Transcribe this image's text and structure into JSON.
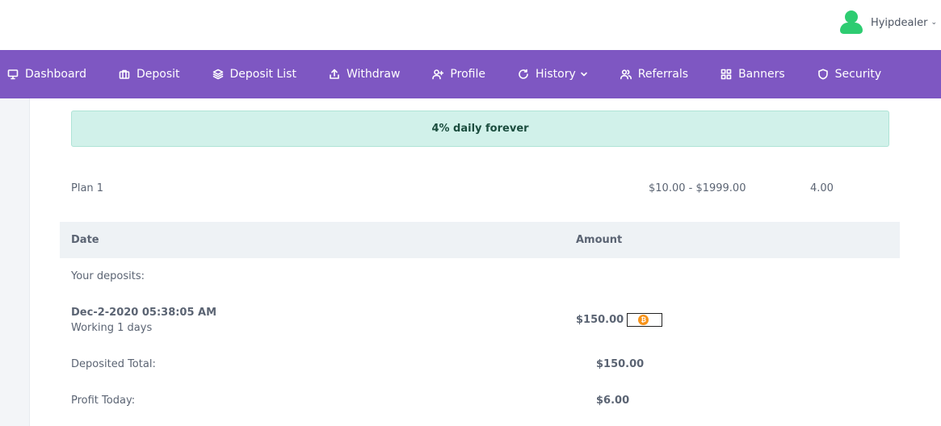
{
  "user": {
    "name": "Hyipdealer",
    "chevron": "⌄"
  },
  "nav": {
    "items": [
      {
        "label": "Dashboard",
        "icon": "monitor-icon"
      },
      {
        "label": "Deposit",
        "icon": "briefcase-icon"
      },
      {
        "label": "Deposit List",
        "icon": "layers-icon"
      },
      {
        "label": "Withdraw",
        "icon": "upload-icon"
      },
      {
        "label": "Profile",
        "icon": "user-plus-icon"
      },
      {
        "label": "History",
        "icon": "refresh-icon"
      },
      {
        "label": "Referrals",
        "icon": "users-icon"
      },
      {
        "label": "Banners",
        "icon": "grid-icon"
      },
      {
        "label": "Security",
        "icon": "shield-icon"
      }
    ]
  },
  "plan": {
    "banner": "4% daily forever",
    "name": "Plan 1",
    "range": "$10.00 - $1999.00",
    "rate": "4.00"
  },
  "table": {
    "col_date": "Date",
    "col_amount": "Amount",
    "your_deposits": "Your deposits:",
    "deposit": {
      "date": "Dec-2-2020 05:38:05 AM",
      "working": "Working 1 days",
      "amount": "$150.00",
      "coin_symbol": "₿"
    },
    "deposited_total_label": "Deposited Total:",
    "deposited_total_value": "$150.00",
    "profit_today_label": "Profit Today:",
    "profit_today_value": "$6.00"
  },
  "colors": {
    "nav_bg": "#7e57c2",
    "banner_bg": "#d1f1ea",
    "avatar": "#2ecc71",
    "coin": "#f7931a"
  }
}
